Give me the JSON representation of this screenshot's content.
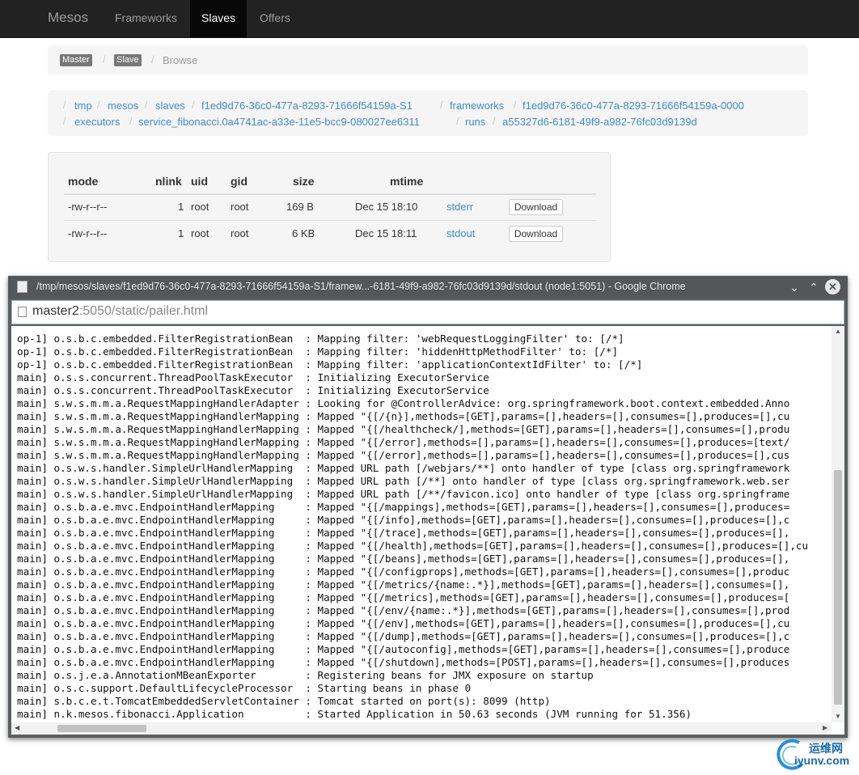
{
  "navbar": {
    "brand": "Mesos",
    "items": [
      {
        "label": "Frameworks",
        "active": false
      },
      {
        "label": "Slaves",
        "active": true
      },
      {
        "label": "Offers",
        "active": false
      }
    ]
  },
  "breadcrumb_top": {
    "master_badge": "Master",
    "slave_badge": "Slave",
    "current": "Browse",
    "separator": "/"
  },
  "path_crumbs": {
    "row1": [
      "tmp",
      "mesos",
      "slaves",
      "f1ed9d76-36c0-477a-8293-71666f54159a-S1",
      "frameworks",
      "f1ed9d76-36c0-477a-8293-71666f54159a-0000"
    ],
    "row2": [
      "executors",
      "service_fibonacci.0a4741ac-a33e-11e5-bcc9-080027ee6311",
      "runs",
      "a55327d6-6181-49f9-a982-76fc03d9139d"
    ]
  },
  "files": {
    "headers": {
      "mode": "mode",
      "nlink": "nlink",
      "uid": "uid",
      "gid": "gid",
      "size": "size",
      "mtime": "mtime"
    },
    "rows": [
      {
        "mode": "-rw-r--r--",
        "nlink": "1",
        "uid": "root",
        "gid": "root",
        "size": "169 B",
        "mtime": "Dec 15 18:10",
        "name": "stderr",
        "action": "Download"
      },
      {
        "mode": "-rw-r--r--",
        "nlink": "1",
        "uid": "root",
        "gid": "root",
        "size": "6 KB",
        "mtime": "Dec 15 18:11",
        "name": "stdout",
        "action": "Download"
      }
    ]
  },
  "popup": {
    "title": "/tmp/mesos/slaves/f1ed9d76-36c0-477a-8293-71666f54159a-S1/framew...-6181-49f9-a982-76fc03d9139d/stdout (node1:5051) - Google Chrome",
    "url_host": "master2",
    "url_rest": ":5050/static/pailer.html",
    "log_lines": [
      "op-1] o.s.b.c.embedded.FilterRegistrationBean  : Mapping filter: 'webRequestLoggingFilter' to: [/*]",
      "op-1] o.s.b.c.embedded.FilterRegistrationBean  : Mapping filter: 'hiddenHttpMethodFilter' to: [/*]",
      "op-1] o.s.b.c.embedded.FilterRegistrationBean  : Mapping filter: 'applicationContextIdFilter' to: [/*]",
      "main] o.s.s.concurrent.ThreadPoolTaskExecutor  : Initializing ExecutorService",
      "main] o.s.s.concurrent.ThreadPoolTaskExecutor  : Initializing ExecutorService",
      "main] s.w.s.m.m.a.RequestMappingHandlerAdapter : Looking for @ControllerAdvice: org.springframework.boot.context.embedded.Anno",
      "main] s.w.s.m.m.a.RequestMappingHandlerMapping : Mapped \"{[/{n}],methods=[GET],params=[],headers=[],consumes=[],produces=[],cu",
      "main] s.w.s.m.m.a.RequestMappingHandlerMapping : Mapped \"{[/healthcheck/],methods=[GET],params=[],headers=[],consumes=[],produ",
      "main] s.w.s.m.m.a.RequestMappingHandlerMapping : Mapped \"{[/error],methods=[],params=[],headers=[],consumes=[],produces=[text/",
      "main] s.w.s.m.m.a.RequestMappingHandlerMapping : Mapped \"{[/error],methods=[],params=[],headers=[],consumes=[],produces=[],cus",
      "main] o.s.w.s.handler.SimpleUrlHandlerMapping  : Mapped URL path [/webjars/**] onto handler of type [class org.springframework",
      "main] o.s.w.s.handler.SimpleUrlHandlerMapping  : Mapped URL path [/**] onto handler of type [class org.springframework.web.ser",
      "main] o.s.w.s.handler.SimpleUrlHandlerMapping  : Mapped URL path [/**/favicon.ico] onto handler of type [class org.springframe",
      "main] o.s.b.a.e.mvc.EndpointHandlerMapping     : Mapped \"{[/mappings],methods=[GET],params=[],headers=[],consumes=[],produces=",
      "main] o.s.b.a.e.mvc.EndpointHandlerMapping     : Mapped \"{[/info],methods=[GET],params=[],headers=[],consumes=[],produces=[],c",
      "main] o.s.b.a.e.mvc.EndpointHandlerMapping     : Mapped \"{[/trace],methods=[GET],params=[],headers=[],consumes=[],produces=[],",
      "main] o.s.b.a.e.mvc.EndpointHandlerMapping     : Mapped \"{[/health],methods=[GET],params=[],headers=[],consumes=[],produces=[],cu",
      "main] o.s.b.a.e.mvc.EndpointHandlerMapping     : Mapped \"{[/beans],methods=[GET],params=[],headers=[],consumes=[],produces=[],",
      "main] o.s.b.a.e.mvc.EndpointHandlerMapping     : Mapped \"{[/configprops],methods=[GET],params=[],headers=[],consumes=[],produc",
      "main] o.s.b.a.e.mvc.EndpointHandlerMapping     : Mapped \"{[/metrics/{name:.*}],methods=[GET],params=[],headers=[],consumes=[],",
      "main] o.s.b.a.e.mvc.EndpointHandlerMapping     : Mapped \"{[/metrics],methods=[GET],params=[],headers=[],consumes=[],produces=[",
      "main] o.s.b.a.e.mvc.EndpointHandlerMapping     : Mapped \"{[/env/{name:.*}],methods=[GET],params=[],headers=[],consumes=[],prod",
      "main] o.s.b.a.e.mvc.EndpointHandlerMapping     : Mapped \"{[/env],methods=[GET],params=[],headers=[],consumes=[],produces=[],cu",
      "main] o.s.b.a.e.mvc.EndpointHandlerMapping     : Mapped \"{[/dump],methods=[GET],params=[],headers=[],consumes=[],produces=[],c",
      "main] o.s.b.a.e.mvc.EndpointHandlerMapping     : Mapped \"{[/autoconfig],methods=[GET],params=[],headers=[],consumes=[],produce",
      "main] o.s.b.a.e.mvc.EndpointHandlerMapping     : Mapped \"{[/shutdown],methods=[POST],params=[],headers=[],consumes=[],produces",
      "main] o.s.j.e.a.AnnotationMBeanExporter        : Registering beans for JMX exposure on startup",
      "main] o.s.c.support.DefaultLifecycleProcessor  : Starting beans in phase 0",
      "main] s.b.c.e.t.TomcatEmbeddedServletContainer : Tomcat started on port(s): 8099 (http)",
      "main] n.k.mesos.fibonacci.Application          : Started Application in 50.63 seconds (JVM running for 51.356)"
    ]
  },
  "watermark": {
    "cn": "运维网",
    "en": "iyunv.com"
  }
}
